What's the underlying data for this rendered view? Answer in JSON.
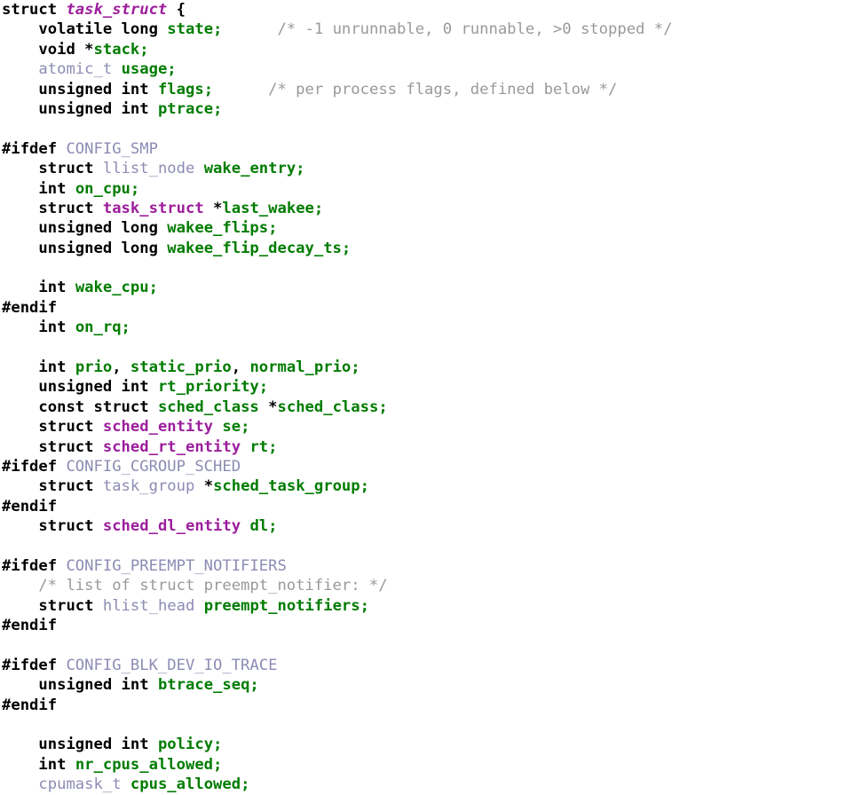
{
  "document": {
    "kind": "source-code-listing",
    "language": "C",
    "struct_name": "task_struct",
    "background": "#ffffff",
    "colors": {
      "keyword": "#000000",
      "type": "#9c1e9c",
      "identifier": "#007c00",
      "comment": "#999999",
      "macro": "#8c8cb4",
      "plain": "#000000"
    }
  },
  "code": {
    "lines": [
      {
        "n": 1,
        "text": "struct task_struct {",
        "tokens": [
          {
            "t": "struct",
            "c": "kw"
          },
          {
            "t": " ",
            "c": "pl"
          },
          {
            "t": "task_struct",
            "c": "typei"
          },
          {
            "t": " {",
            "c": "pl"
          }
        ]
      },
      {
        "n": 2,
        "text": "    volatile long state;\t/* -1 unrunnable, 0 runnable, >0 stopped */",
        "tokens": [
          {
            "t": "    ",
            "c": "pl"
          },
          {
            "t": "volatile long",
            "c": "kw"
          },
          {
            "t": " ",
            "c": "pl"
          },
          {
            "t": "state;",
            "c": "id"
          },
          {
            "t": "      ",
            "c": "pl"
          },
          {
            "t": "/* -1 unrunnable, 0 runnable, >0 stopped */",
            "c": "cm"
          }
        ]
      },
      {
        "n": 3,
        "text": "    void *stack;",
        "tokens": [
          {
            "t": "    ",
            "c": "pl"
          },
          {
            "t": "void",
            "c": "kw"
          },
          {
            "t": " ",
            "c": "pl"
          },
          {
            "t": "*",
            "c": "op"
          },
          {
            "t": "stack;",
            "c": "id"
          }
        ]
      },
      {
        "n": 4,
        "text": "    atomic_t usage;",
        "tokens": [
          {
            "t": "    ",
            "c": "pl"
          },
          {
            "t": "atomic_t",
            "c": "utype"
          },
          {
            "t": " ",
            "c": "pl"
          },
          {
            "t": "usage;",
            "c": "id"
          }
        ]
      },
      {
        "n": 5,
        "text": "    unsigned int flags;\t/* per process flags, defined below */",
        "tokens": [
          {
            "t": "    ",
            "c": "pl"
          },
          {
            "t": "unsigned int",
            "c": "kw"
          },
          {
            "t": " ",
            "c": "pl"
          },
          {
            "t": "flags;",
            "c": "id"
          },
          {
            "t": "      ",
            "c": "pl"
          },
          {
            "t": "/* per process flags, defined below */",
            "c": "cm"
          }
        ]
      },
      {
        "n": 6,
        "text": "    unsigned int ptrace;",
        "tokens": [
          {
            "t": "    ",
            "c": "pl"
          },
          {
            "t": "unsigned int",
            "c": "kw"
          },
          {
            "t": " ",
            "c": "pl"
          },
          {
            "t": "ptrace;",
            "c": "id"
          }
        ]
      },
      {
        "n": 7,
        "text": "",
        "tokens": []
      },
      {
        "n": 8,
        "text": "#ifdef CONFIG_SMP",
        "tokens": [
          {
            "t": "#ifdef",
            "c": "pp"
          },
          {
            "t": " ",
            "c": "pl"
          },
          {
            "t": "CONFIG_SMP",
            "c": "macro"
          }
        ]
      },
      {
        "n": 9,
        "text": "    struct llist_node wake_entry;",
        "tokens": [
          {
            "t": "    ",
            "c": "pl"
          },
          {
            "t": "struct",
            "c": "kw"
          },
          {
            "t": " ",
            "c": "pl"
          },
          {
            "t": "llist_node",
            "c": "utype"
          },
          {
            "t": " ",
            "c": "pl"
          },
          {
            "t": "wake_entry;",
            "c": "id"
          }
        ]
      },
      {
        "n": 10,
        "text": "    int on_cpu;",
        "tokens": [
          {
            "t": "    ",
            "c": "pl"
          },
          {
            "t": "int",
            "c": "kw"
          },
          {
            "t": " ",
            "c": "pl"
          },
          {
            "t": "on_cpu;",
            "c": "id"
          }
        ]
      },
      {
        "n": 11,
        "text": "    struct task_struct *last_wakee;",
        "tokens": [
          {
            "t": "    ",
            "c": "pl"
          },
          {
            "t": "struct",
            "c": "kw"
          },
          {
            "t": " ",
            "c": "pl"
          },
          {
            "t": "task_struct",
            "c": "type"
          },
          {
            "t": " ",
            "c": "pl"
          },
          {
            "t": "*",
            "c": "op"
          },
          {
            "t": "last_wakee;",
            "c": "id"
          }
        ]
      },
      {
        "n": 12,
        "text": "    unsigned long wakee_flips;",
        "tokens": [
          {
            "t": "    ",
            "c": "pl"
          },
          {
            "t": "unsigned long",
            "c": "kw"
          },
          {
            "t": " ",
            "c": "pl"
          },
          {
            "t": "wakee_flips;",
            "c": "id"
          }
        ]
      },
      {
        "n": 13,
        "text": "    unsigned long wakee_flip_decay_ts;",
        "tokens": [
          {
            "t": "    ",
            "c": "pl"
          },
          {
            "t": "unsigned long",
            "c": "kw"
          },
          {
            "t": " ",
            "c": "pl"
          },
          {
            "t": "wakee_flip_decay_ts;",
            "c": "id"
          }
        ]
      },
      {
        "n": 14,
        "text": "",
        "tokens": []
      },
      {
        "n": 15,
        "text": "    int wake_cpu;",
        "tokens": [
          {
            "t": "    ",
            "c": "pl"
          },
          {
            "t": "int",
            "c": "kw"
          },
          {
            "t": " ",
            "c": "pl"
          },
          {
            "t": "wake_cpu;",
            "c": "id"
          }
        ]
      },
      {
        "n": 16,
        "text": "#endif",
        "tokens": [
          {
            "t": "#endif",
            "c": "pp"
          }
        ]
      },
      {
        "n": 17,
        "text": "    int on_rq;",
        "tokens": [
          {
            "t": "    ",
            "c": "pl"
          },
          {
            "t": "int",
            "c": "kw"
          },
          {
            "t": " ",
            "c": "pl"
          },
          {
            "t": "on_rq;",
            "c": "id"
          }
        ]
      },
      {
        "n": 18,
        "text": "",
        "tokens": []
      },
      {
        "n": 19,
        "text": "    int prio, static_prio, normal_prio;",
        "tokens": [
          {
            "t": "    ",
            "c": "pl"
          },
          {
            "t": "int",
            "c": "kw"
          },
          {
            "t": " ",
            "c": "pl"
          },
          {
            "t": "prio",
            "c": "id"
          },
          {
            "t": ", ",
            "c": "pl"
          },
          {
            "t": "static_prio",
            "c": "id"
          },
          {
            "t": ", ",
            "c": "pl"
          },
          {
            "t": "normal_prio;",
            "c": "id"
          }
        ]
      },
      {
        "n": 20,
        "text": "    unsigned int rt_priority;",
        "tokens": [
          {
            "t": "    ",
            "c": "pl"
          },
          {
            "t": "unsigned int",
            "c": "kw"
          },
          {
            "t": " ",
            "c": "pl"
          },
          {
            "t": "rt_priority;",
            "c": "id"
          }
        ]
      },
      {
        "n": 21,
        "text": "    const struct sched_class *sched_class;",
        "tokens": [
          {
            "t": "    ",
            "c": "pl"
          },
          {
            "t": "const struct",
            "c": "kw"
          },
          {
            "t": " ",
            "c": "pl"
          },
          {
            "t": "sched_class",
            "c": "id"
          },
          {
            "t": " ",
            "c": "pl"
          },
          {
            "t": "*",
            "c": "op"
          },
          {
            "t": "sched_class;",
            "c": "id"
          }
        ]
      },
      {
        "n": 22,
        "text": "    struct sched_entity se;",
        "tokens": [
          {
            "t": "    ",
            "c": "pl"
          },
          {
            "t": "struct",
            "c": "kw"
          },
          {
            "t": " ",
            "c": "pl"
          },
          {
            "t": "sched_entity",
            "c": "type"
          },
          {
            "t": " ",
            "c": "pl"
          },
          {
            "t": "se;",
            "c": "id"
          }
        ]
      },
      {
        "n": 23,
        "text": "    struct sched_rt_entity rt;",
        "tokens": [
          {
            "t": "    ",
            "c": "pl"
          },
          {
            "t": "struct",
            "c": "kw"
          },
          {
            "t": " ",
            "c": "pl"
          },
          {
            "t": "sched_rt_entity",
            "c": "type"
          },
          {
            "t": " ",
            "c": "pl"
          },
          {
            "t": "rt;",
            "c": "id"
          }
        ]
      },
      {
        "n": 24,
        "text": "#ifdef CONFIG_CGROUP_SCHED",
        "tokens": [
          {
            "t": "#ifdef",
            "c": "pp"
          },
          {
            "t": " ",
            "c": "pl"
          },
          {
            "t": "CONFIG_CGROUP_SCHED",
            "c": "macro"
          }
        ]
      },
      {
        "n": 25,
        "text": "    struct task_group *sched_task_group;",
        "tokens": [
          {
            "t": "    ",
            "c": "pl"
          },
          {
            "t": "struct",
            "c": "kw"
          },
          {
            "t": " ",
            "c": "pl"
          },
          {
            "t": "task_group",
            "c": "utype"
          },
          {
            "t": " ",
            "c": "pl"
          },
          {
            "t": "*",
            "c": "op"
          },
          {
            "t": "sched_task_group;",
            "c": "id"
          }
        ]
      },
      {
        "n": 26,
        "text": "#endif",
        "tokens": [
          {
            "t": "#endif",
            "c": "pp"
          }
        ]
      },
      {
        "n": 27,
        "text": "    struct sched_dl_entity dl;",
        "tokens": [
          {
            "t": "    ",
            "c": "pl"
          },
          {
            "t": "struct",
            "c": "kw"
          },
          {
            "t": " ",
            "c": "pl"
          },
          {
            "t": "sched_dl_entity",
            "c": "type"
          },
          {
            "t": " ",
            "c": "pl"
          },
          {
            "t": "dl;",
            "c": "id"
          }
        ]
      },
      {
        "n": 28,
        "text": "",
        "tokens": []
      },
      {
        "n": 29,
        "text": "#ifdef CONFIG_PREEMPT_NOTIFIERS",
        "tokens": [
          {
            "t": "#ifdef",
            "c": "pp"
          },
          {
            "t": " ",
            "c": "pl"
          },
          {
            "t": "CONFIG_PREEMPT_NOTIFIERS",
            "c": "macro"
          }
        ]
      },
      {
        "n": 30,
        "text": "    /* list of struct preempt_notifier: */",
        "tokens": [
          {
            "t": "    ",
            "c": "pl"
          },
          {
            "t": "/* list of struct preempt_notifier: */",
            "c": "cm"
          }
        ]
      },
      {
        "n": 31,
        "text": "    struct hlist_head preempt_notifiers;",
        "tokens": [
          {
            "t": "    ",
            "c": "pl"
          },
          {
            "t": "struct",
            "c": "kw"
          },
          {
            "t": " ",
            "c": "pl"
          },
          {
            "t": "hlist_head",
            "c": "utype"
          },
          {
            "t": " ",
            "c": "pl"
          },
          {
            "t": "preempt_notifiers;",
            "c": "id"
          }
        ]
      },
      {
        "n": 32,
        "text": "#endif",
        "tokens": [
          {
            "t": "#endif",
            "c": "pp"
          }
        ]
      },
      {
        "n": 33,
        "text": "",
        "tokens": []
      },
      {
        "n": 34,
        "text": "#ifdef CONFIG_BLK_DEV_IO_TRACE",
        "tokens": [
          {
            "t": "#ifdef",
            "c": "pp"
          },
          {
            "t": " ",
            "c": "pl"
          },
          {
            "t": "CONFIG_BLK_DEV_IO_TRACE",
            "c": "macro"
          }
        ]
      },
      {
        "n": 35,
        "text": "    unsigned int btrace_seq;",
        "tokens": [
          {
            "t": "    ",
            "c": "pl"
          },
          {
            "t": "unsigned int",
            "c": "kw"
          },
          {
            "t": " ",
            "c": "pl"
          },
          {
            "t": "btrace_seq;",
            "c": "id"
          }
        ]
      },
      {
        "n": 36,
        "text": "#endif",
        "tokens": [
          {
            "t": "#endif",
            "c": "pp"
          }
        ]
      },
      {
        "n": 37,
        "text": "",
        "tokens": []
      },
      {
        "n": 38,
        "text": "    unsigned int policy;",
        "tokens": [
          {
            "t": "    ",
            "c": "pl"
          },
          {
            "t": "unsigned int",
            "c": "kw"
          },
          {
            "t": " ",
            "c": "pl"
          },
          {
            "t": "policy;",
            "c": "id"
          }
        ]
      },
      {
        "n": 39,
        "text": "    int nr_cpus_allowed;",
        "tokens": [
          {
            "t": "    ",
            "c": "pl"
          },
          {
            "t": "int",
            "c": "kw"
          },
          {
            "t": " ",
            "c": "pl"
          },
          {
            "t": "nr_cpus_allowed;",
            "c": "id"
          }
        ]
      },
      {
        "n": 40,
        "text": "    cpumask_t cpus_allowed;",
        "tokens": [
          {
            "t": "    ",
            "c": "pl"
          },
          {
            "t": "cpumask_t",
            "c": "utype"
          },
          {
            "t": " ",
            "c": "pl"
          },
          {
            "t": "cpus_allowed;",
            "c": "id"
          }
        ]
      }
    ]
  }
}
